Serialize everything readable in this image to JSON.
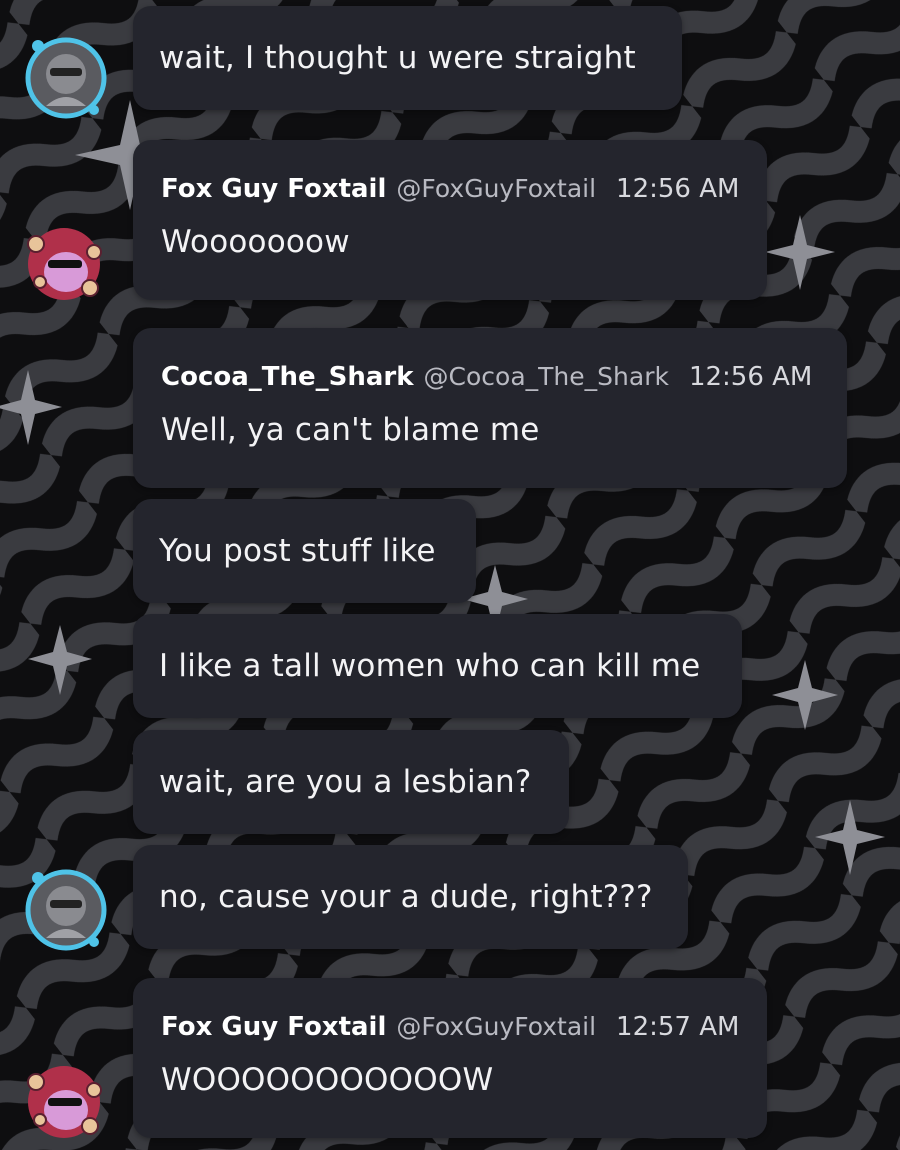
{
  "colors": {
    "bubble": "#24252d",
    "background": "#0e0e10",
    "avatar_ring": "#4fc3e8",
    "avatar_hair": "#b0304a"
  },
  "messages": [
    {
      "type": "continuation",
      "text": "wait, I thought u were straight"
    },
    {
      "type": "header",
      "author": "Fox Guy Foxtail",
      "handle": "@FoxGuyFoxtail",
      "time": "12:56 AM",
      "text": "Wooooooow"
    },
    {
      "type": "header",
      "author": "Cocoa_The_Shark",
      "handle": "@Cocoa_The_Shark",
      "time": "12:56 AM",
      "text": "Well, ya can't blame me"
    },
    {
      "type": "continuation",
      "text": "You post stuff like"
    },
    {
      "type": "continuation",
      "text": "I like a tall women who can kill me"
    },
    {
      "type": "continuation",
      "text": "wait, are you a lesbian?"
    },
    {
      "type": "continuation",
      "text": "no, cause your a dude, right???"
    },
    {
      "type": "header",
      "author": "Fox Guy Foxtail",
      "handle": "@FoxGuyFoxtail",
      "time": "12:57 AM",
      "text": "WOOOOOOOOOOOW"
    }
  ],
  "avatars": {
    "shark": "shark-avatar-icon",
    "fox": "fox-avatar-icon"
  }
}
